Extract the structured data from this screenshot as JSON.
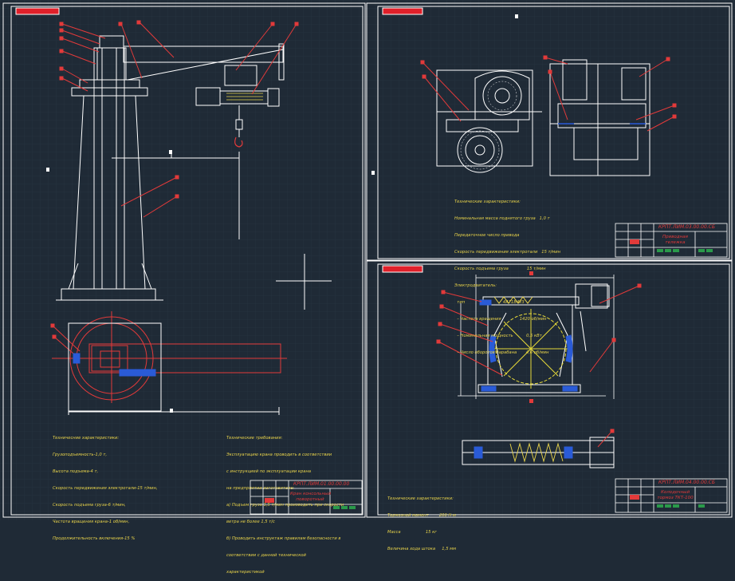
{
  "colors": {
    "background": "#1f2a36",
    "frame": "#ffffff",
    "geometry_white": "#ffffff",
    "geometry_red": "#e23a3a",
    "hatch_yellow": "#e8d34a",
    "dimension_blue": "#2a5bd7",
    "axis_yellow": "#e5d83a",
    "title_block_green": "#2a9a4a"
  },
  "sheet1": {
    "tech_notes_title": "Техничесние характеристики:",
    "tech_notes_lines": [
      "Грузоподъемность-1,0 т,",
      "Высота подъема-4 т,",
      "Скорость передвижения электротали-15 т/мин,",
      "Скорость подъема груза-6 т/мин,",
      "Частота вращения крана-1 об/мин,",
      "Продолжительность включения-15 %"
    ],
    "req_notes_title": "Технические требования:",
    "req_notes_lines": [
      "Эксплуатацию крана проводить в соответствии",
      "с инструкцией по эксплуатации крана",
      "на предприятии изготовителе:",
      "а) Подъем груза 1,5 т/мин производить при скорости",
      "ветра не более 1,5 т/с",
      "б) Проводить инструктаж правилам безопасности в",
      "соответствии с данной технической",
      "характеристикой"
    ],
    "title_block_code": "КРПТ.ЛИМ.01.00.00.00",
    "title_block_name": "Кран консольный\nповоротный"
  },
  "sheet2": {
    "tech_notes_title": "Технические характеристики:",
    "tech_notes_lines": [
      "Номинальная масса поднятого груза   1,0 т",
      "Передаточное число привода",
      "Скорость передвижения электротали   15 т/мин",
      "Скорость подъема груза              15 т/мин",
      "Электродвигатель:",
      "  тип                             4А71В4У3",
      "  – Частота вращения              1420 об/мин",
      "  – Номинальная мощность          0,5 кВт",
      "  – Число оборотов барабана       4,6 об/мин"
    ],
    "title_block_code": "КРПТ.ЛИМ.03.00.00.СБ",
    "title_block_name": "Приводная\nтележка"
  },
  "sheet3": {
    "tech_notes_title": "Технические характеристики:",
    "tech_notes_lines": [
      "Тормозной момент        200 Н·м",
      "Масса                   15 кг",
      "Величина хода штока     1,5 мм"
    ],
    "title_block_code": "КРПТ.ЛИМ.04.00.00.СБ",
    "title_block_name": "Колодочный\nтормоз ТКТ-100"
  }
}
